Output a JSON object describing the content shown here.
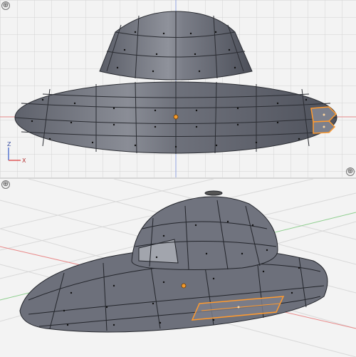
{
  "viewports": {
    "front": {
      "axis_z_label": "Z",
      "axis_x_label": "X",
      "corner_button_glyph": "⊕",
      "colors": {
        "grid": "#d2d2d2",
        "x_axis": "#e05858",
        "z_axis": "#5a78d0",
        "mesh_fill": "#6a6d78",
        "mesh_shadow": "#4b4e57",
        "mesh_light": "#8d9099",
        "selection": "#ff9b30"
      }
    },
    "perspective": {
      "corner_button_glyph": "⊕",
      "colors": {
        "grid": "#d8d8d8",
        "mesh_fill": "#6d707b",
        "mesh_light": "#9da0a8",
        "selection": "#ff9b30"
      }
    }
  },
  "objects": {
    "model_name": "",
    "selected_face_visible": true,
    "origin_marker": "orange-dot"
  }
}
